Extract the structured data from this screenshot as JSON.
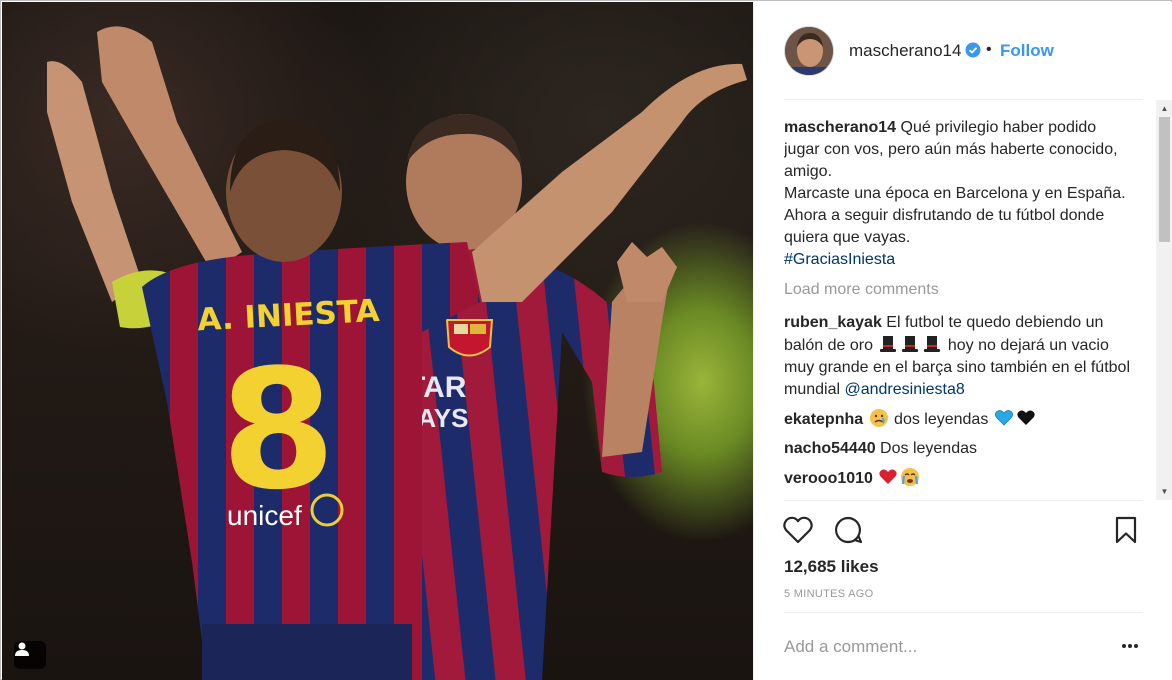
{
  "post": {
    "username": "mascherano14",
    "follow_label": "Follow",
    "separator": "•",
    "caption": {
      "username": "mascherano14",
      "line1": " Qué privilegio haber podido jugar con vos, pero aún más haberte conocido, amigo.",
      "line2": "Marcaste una época en Barcelona y en España. Ahora a seguir disfrutando de tu fútbol donde quiera que vayas.",
      "hashtag": "#GraciasIniesta"
    },
    "load_more": "Load more comments",
    "comments": [
      {
        "username": "ruben_kayak",
        "text_before": " El futbol te quedo debiendo un balón de oro ",
        "emoji": [
          "top-hat",
          "top-hat",
          "top-hat"
        ],
        "text_after": " hoy no dejará un vacio muy grande en el barça sino también en el fútbol mundial ",
        "mention": "@andresiniesta8"
      },
      {
        "username": "ekatepnha",
        "emoji_before": "disappointed-face",
        "text": " dos leyendas ",
        "emoji_after": [
          "blue-heart",
          "black-heart"
        ]
      },
      {
        "username": "nacho54440",
        "text": " Dos leyendas"
      },
      {
        "username": "verooo1010",
        "emoji_after": [
          "red-heart",
          "crying-face"
        ]
      }
    ],
    "likes": "12,685 likes",
    "time": "5 MINUTES AGO",
    "add_comment_placeholder": "Add a comment...",
    "jersey_name": "A. INIESTA",
    "jersey_number": "8",
    "sponsor": "unicef",
    "shirt_text_1": "TAR",
    "shirt_text_2": "VAYS"
  },
  "colors": {
    "link": "#3897f0",
    "mention": "#003569",
    "muted": "#999999",
    "text": "#262626",
    "divider": "#efefef"
  },
  "icons": [
    "tag-person-icon",
    "verified-icon",
    "heart-icon",
    "comment-icon",
    "bookmark-icon",
    "more-icon"
  ]
}
